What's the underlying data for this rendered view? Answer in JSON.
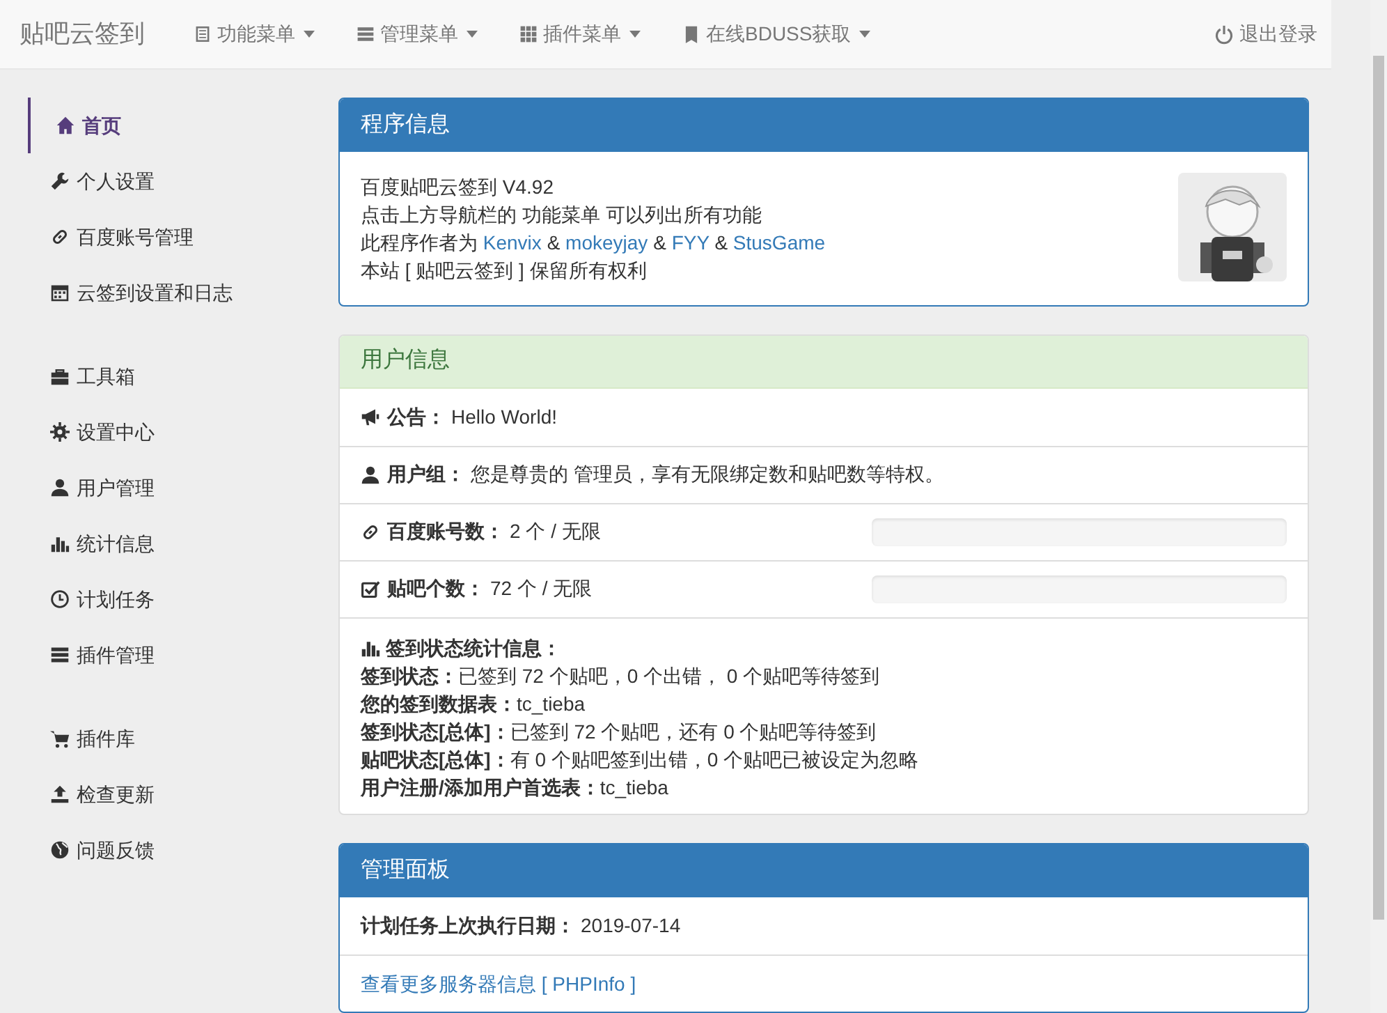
{
  "navbar": {
    "brand": "贴吧云签到",
    "menus": [
      {
        "label": "功能菜单"
      },
      {
        "label": "管理菜单"
      },
      {
        "label": "插件菜单"
      },
      {
        "label": "在线BDUSS获取"
      }
    ],
    "logout": {
      "label": "退出登录"
    }
  },
  "sidebar": {
    "groups": [
      [
        {
          "label": "首页",
          "selected": true
        },
        {
          "label": "个人设置",
          "selected": false
        },
        {
          "label": "百度账号管理",
          "selected": false
        },
        {
          "label": "云签到设置和日志",
          "selected": false
        }
      ],
      [
        {
          "label": "工具箱",
          "selected": false
        },
        {
          "label": "设置中心",
          "selected": false
        },
        {
          "label": "用户管理",
          "selected": false
        },
        {
          "label": "统计信息",
          "selected": false
        },
        {
          "label": "计划任务",
          "selected": false
        },
        {
          "label": "插件管理",
          "selected": false
        }
      ],
      [
        {
          "label": "插件库",
          "selected": false
        },
        {
          "label": "检查更新",
          "selected": false
        },
        {
          "label": "问题反馈",
          "selected": false
        }
      ]
    ]
  },
  "program_panel": {
    "title": "程序信息",
    "lines": [
      "百度贴吧云签到 V4.92",
      "点击上方导航栏的 功能菜单 可以列出所有功能"
    ],
    "authors": {
      "prefix": "此程序作者为",
      "names": [
        "Kenvix",
        "mokeyjay",
        "FYY",
        "StusGame"
      ],
      "separator": "&"
    },
    "footer": "本站 [ 贴吧云签到 ] 保留所有权利",
    "avatar": {
      "kind": "picture"
    }
  },
  "user_panel": {
    "title": "用户信息",
    "rows": [
      {
        "kind": "text",
        "label": "公告：",
        "value": "Hello World!"
      },
      {
        "kind": "text",
        "label": "用户组：",
        "value": "您是尊贵的 管理员，享有无限绑定数和贴吧数等特权。"
      },
      {
        "kind": "progress",
        "label": "百度账号数：",
        "value": "2 个 / 无限",
        "level": 0
      },
      {
        "kind": "progress",
        "label": "贴吧个数：",
        "value": "72 个 / 无限",
        "level": 0
      },
      {
        "kind": "stats",
        "label": "签到状态统计信息：",
        "lines": [
          {
            "label": "签到状态：",
            "value": "已签到 72 个贴吧，0 个出错， 0 个贴吧等待签到"
          },
          {
            "label": "您的签到数据表：",
            "value": "tc_tieba"
          },
          {
            "label": "签到状态[总体]：",
            "value": "已签到 72 个贴吧，还有 0 个贴吧等待签到"
          },
          {
            "label": "贴吧状态[总体]：",
            "value": "有 0 个贴吧签到出错，0 个贴吧已被设定为忽略"
          },
          {
            "label": "用户注册/添加用户首选表：",
            "value": "tc_tieba"
          }
        ]
      }
    ]
  },
  "admin_panel": {
    "title": "管理面板",
    "rows": [
      {
        "kind": "text",
        "label": "计划任务上次执行日期：",
        "value": "2019-07-14"
      },
      {
        "kind": "link",
        "value": "查看更多服务器信息 [ PHPInfo ]"
      }
    ]
  }
}
